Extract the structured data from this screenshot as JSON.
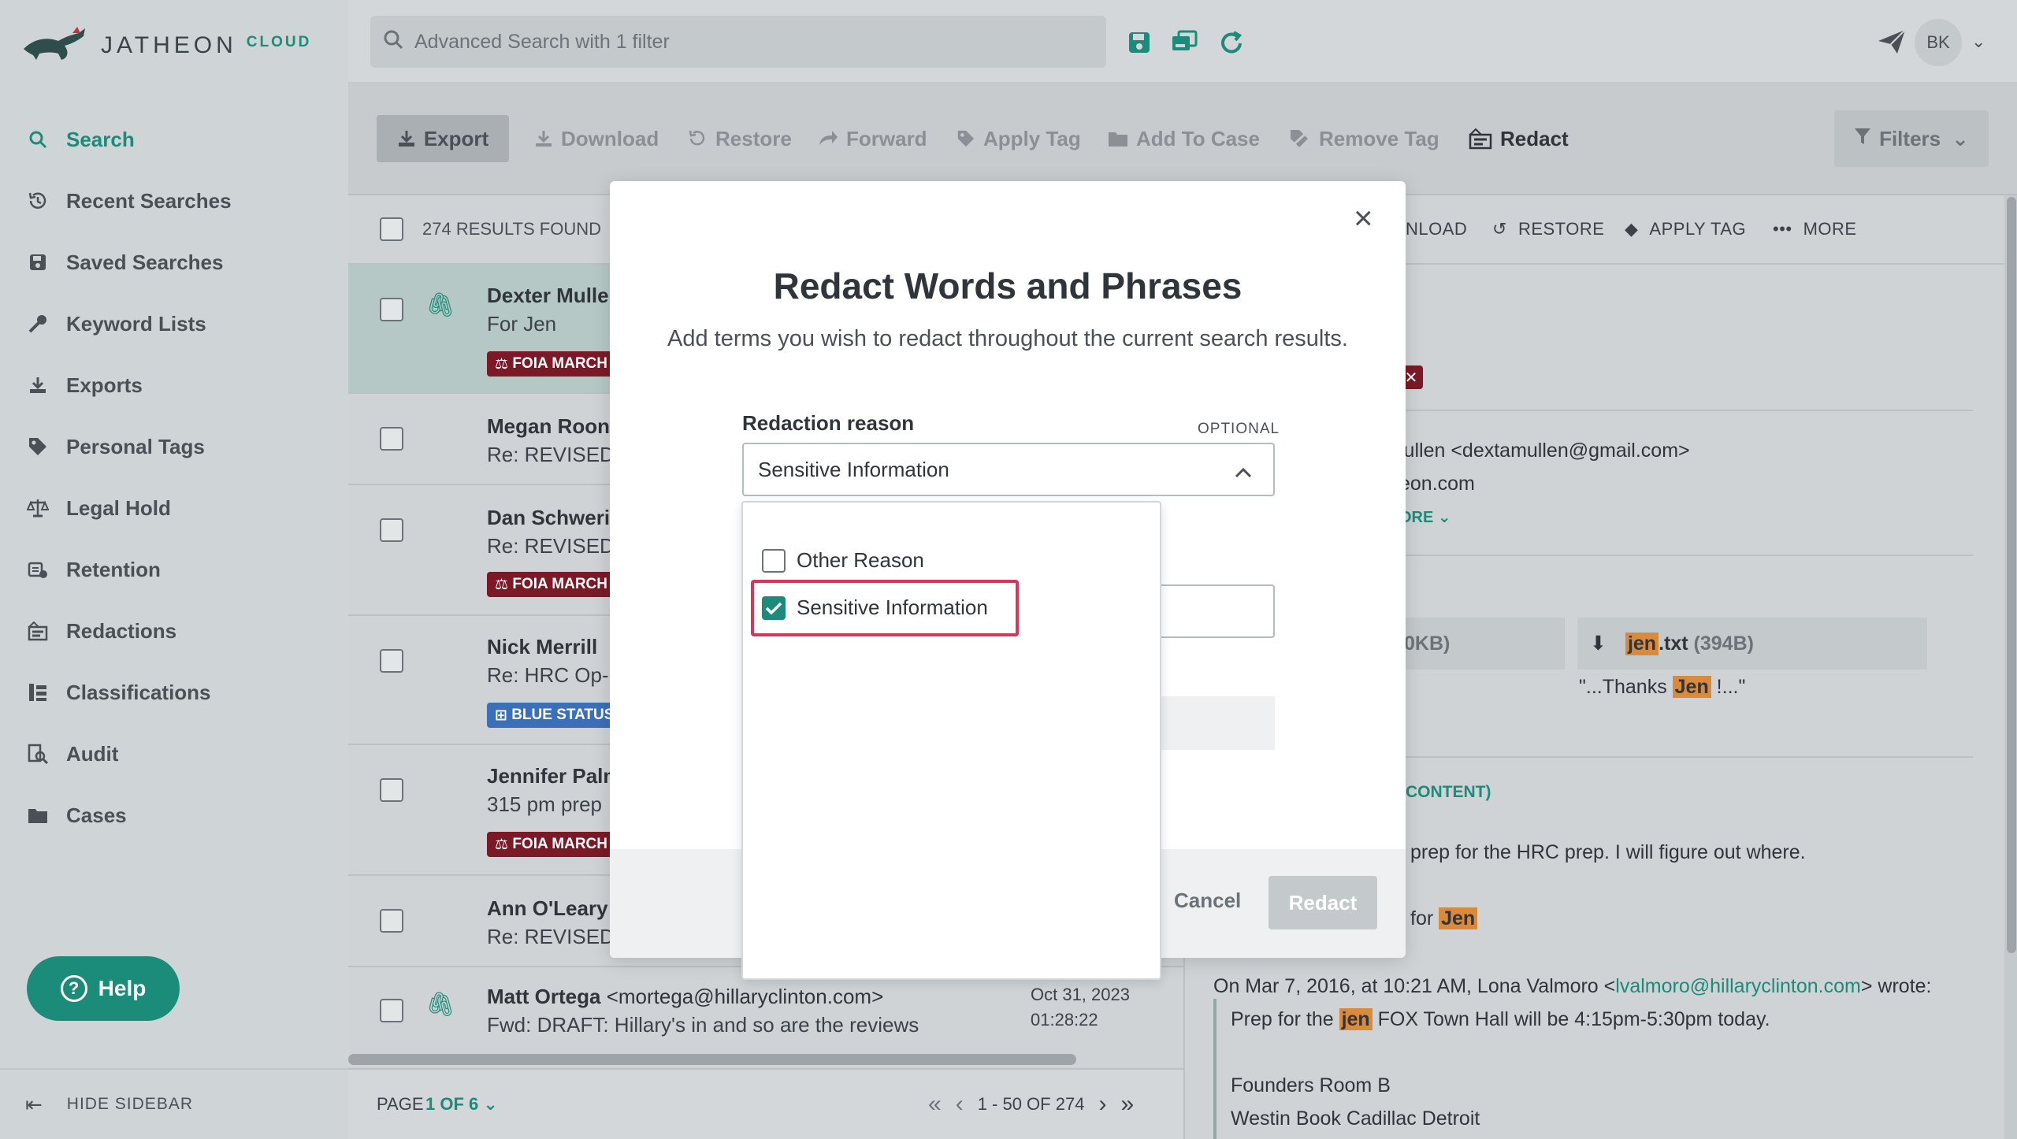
{
  "brand": {
    "name": "JATHEON",
    "sub": "CLOUD"
  },
  "colors": {
    "accent": "#1b8b7a",
    "tag_red": "#7b1a26",
    "tag_blue": "#3b6fb8",
    "highlight": "#d98a3a",
    "focus_outline": "#d6365a"
  },
  "sidebar": {
    "items": [
      {
        "label": "Search",
        "icon": "search-icon",
        "active": true
      },
      {
        "label": "Recent Searches",
        "icon": "history-icon"
      },
      {
        "label": "Saved Searches",
        "icon": "save-icon"
      },
      {
        "label": "Keyword Lists",
        "icon": "key-icon"
      },
      {
        "label": "Exports",
        "icon": "download-icon"
      },
      {
        "label": "Personal Tags",
        "icon": "tag-icon"
      },
      {
        "label": "Legal Hold",
        "icon": "scale-icon"
      },
      {
        "label": "Retention",
        "icon": "retention-icon"
      },
      {
        "label": "Redactions",
        "icon": "redaction-icon"
      },
      {
        "label": "Classifications",
        "icon": "classification-icon"
      },
      {
        "label": "Audit",
        "icon": "audit-icon"
      },
      {
        "label": "Cases",
        "icon": "folder-icon"
      }
    ],
    "help_label": "Help",
    "hide_label": "HIDE SIDEBAR"
  },
  "topbar": {
    "search_placeholder": "Advanced Search with 1 filter",
    "avatar_initials": "BK"
  },
  "toolbar": {
    "export": "Export",
    "download": "Download",
    "restore": "Restore",
    "forward": "Forward",
    "apply_tag": "Apply Tag",
    "add_to_case": "Add To Case",
    "remove_tag": "Remove Tag",
    "redact": "Redact",
    "filters": "Filters"
  },
  "results": {
    "count_label": "274 RESULTS FOUND",
    "rows": [
      {
        "from": "Dexter Mulle",
        "subject": "For Jen",
        "tag": "FOIA MARCH",
        "tag_color": "red",
        "attachment": true
      },
      {
        "from": "Megan Roone",
        "subject": "Re: REVISED F"
      },
      {
        "from": "Dan Schweri",
        "subject": "Re: REVISED F",
        "tag": "FOIA MARCH",
        "tag_color": "red"
      },
      {
        "from": "Nick Merrill",
        "subject": "Re: HRC Op-E",
        "tag": "BLUE STATUS",
        "tag_color": "blue"
      },
      {
        "from": "Jennifer Palm",
        "subject": "315 pm prep",
        "tag": "FOIA MARCH",
        "tag_color": "red"
      },
      {
        "from": "Ann O'Leary",
        "subject": "Re: REVISED F"
      },
      {
        "from": "Matt Ortega",
        "email": "<mortega@hillaryclinton.com>",
        "subject": "Fwd: DRAFT: Hillary's in and so are the reviews",
        "date": "Oct 31, 2023",
        "time": "01:28:22",
        "attachment": true
      }
    ]
  },
  "pagination": {
    "page_label": "PAGE",
    "page_value": "1 OF 6",
    "range": "1 - 50 OF 274"
  },
  "preview": {
    "actions": {
      "download": "NLOAD",
      "restore": "RESTORE",
      "apply_tag": "APPLY TAG",
      "more": "MORE"
    },
    "from_line": "lullen <dextamullen@gmail.com>",
    "to_line": "eon.com",
    "more_link": "ORE",
    "attachment1_size": "0KB)",
    "attachment2_name": "jen",
    "attachment2_ext": ".txt",
    "attachment2_size": "(394B)",
    "snippet_pre": "\"...Thanks ",
    "snippet_hl": "Jen",
    "snippet_post": " !...\"",
    "content_label": "CONTENT)",
    "body_line1": "prep for the HRC prep.  I will figure out where.",
    "body_line2_pre": "for ",
    "body_line2_hl": "Jen",
    "quote_header_pre": "On Mar 7, 2016, at 10:21 AM, Lona Valmoro <",
    "quote_header_link": "lvalmoro@hillaryclinton.com",
    "quote_header_post": "> wrote:",
    "quote_line1_pre": "Prep for the ",
    "quote_line1_hl": "jen",
    "quote_line1_post": " FOX Town Hall will be 4:15pm-5:30pm today.",
    "quote_line2": "Founders Room B",
    "quote_line3": "Westin Book Cadillac Detroit"
  },
  "modal": {
    "title": "Redact Words and Phrases",
    "subtitle": "Add terms you wish to redact throughout the current search results.",
    "reason_label": "Redaction reason",
    "optional_label": "OPTIONAL",
    "reason_value": "Sensitive Information",
    "options": [
      {
        "label": "Other Reason",
        "checked": false
      },
      {
        "label": "Sensitive Information",
        "checked": true
      }
    ],
    "cancel": "Cancel",
    "redact": "Redact"
  }
}
